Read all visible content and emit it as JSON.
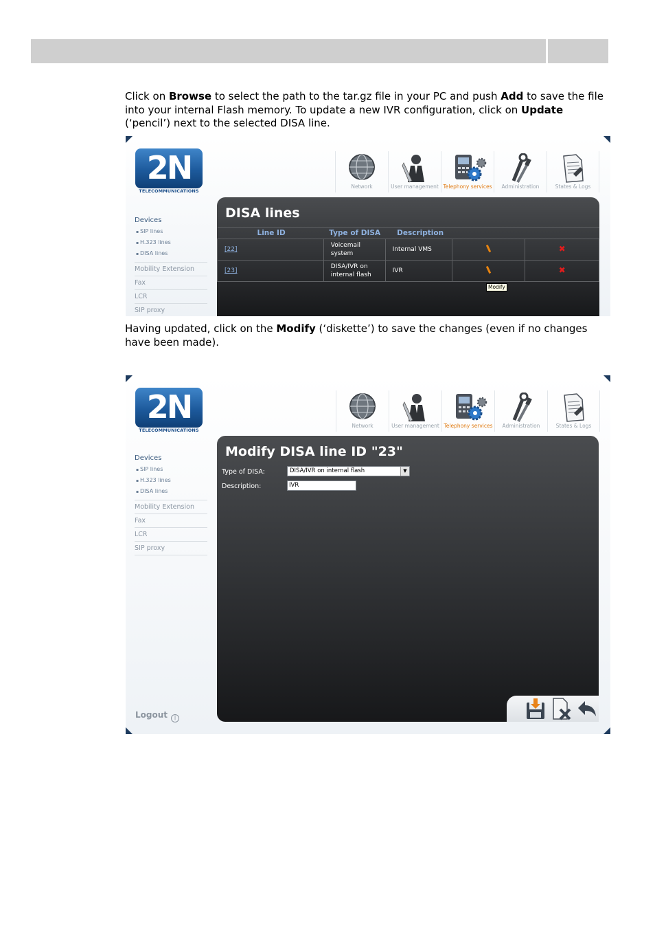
{
  "paragraphs": {
    "p1": {
      "t1": "Click on ",
      "b1": "Browse",
      "t2": " to select the path to the tar.gz file in your PC and push ",
      "b2": "Add",
      "t3": " to save the file into your internal Flash memory. To update a new IVR configuration, click on ",
      "b3": "Update",
      "t4": " (‘pencil’) next to the selected DISA line."
    },
    "p2": {
      "t1": "Having updated, click on the ",
      "b1": "Modify",
      "t2": " (‘diskette’) to save the changes (even if no changes have been made)."
    }
  },
  "app": {
    "logo_text": "2N",
    "logo_subtitle": "TELECOMMUNICATIONS",
    "nav": [
      {
        "label": "Network",
        "icon": "globe-icon"
      },
      {
        "label": "User management",
        "icon": "user-icon"
      },
      {
        "label": "Telephony services",
        "icon": "phone-gear-icon",
        "active": true
      },
      {
        "label": "Administration",
        "icon": "tools-icon"
      },
      {
        "label": "States & Logs",
        "icon": "document-icon"
      }
    ],
    "sidebar": {
      "devices": "Devices",
      "sub": [
        "SIP lines",
        "H.323 lines",
        "DISA lines"
      ],
      "items": [
        "Mobility Extension",
        "Fax",
        "LCR",
        "SIP proxy"
      ]
    },
    "logout": "Logout",
    "accent_color": "#e07a10"
  },
  "screen1": {
    "title": "DISA lines",
    "columns": [
      "Line ID",
      "Type of DISA",
      "Description"
    ],
    "rows": [
      {
        "id": "[22]",
        "type": "Voicemail system",
        "type_l1": "Voicemail",
        "type_l2": "system",
        "description": "Internal VMS"
      },
      {
        "id": "[23]",
        "type": "DISA/IVR on internal flash",
        "type_l1": "DISA/IVR on",
        "type_l2": "internal flash",
        "description": "IVR"
      }
    ],
    "tooltip": "Modify"
  },
  "screen2": {
    "title": "Modify DISA line ID \"23\"",
    "type_label": "Type of DISA:",
    "type_value": "DISA/IVR on internal flash",
    "description_label": "Description:",
    "description_value": "IVR"
  }
}
